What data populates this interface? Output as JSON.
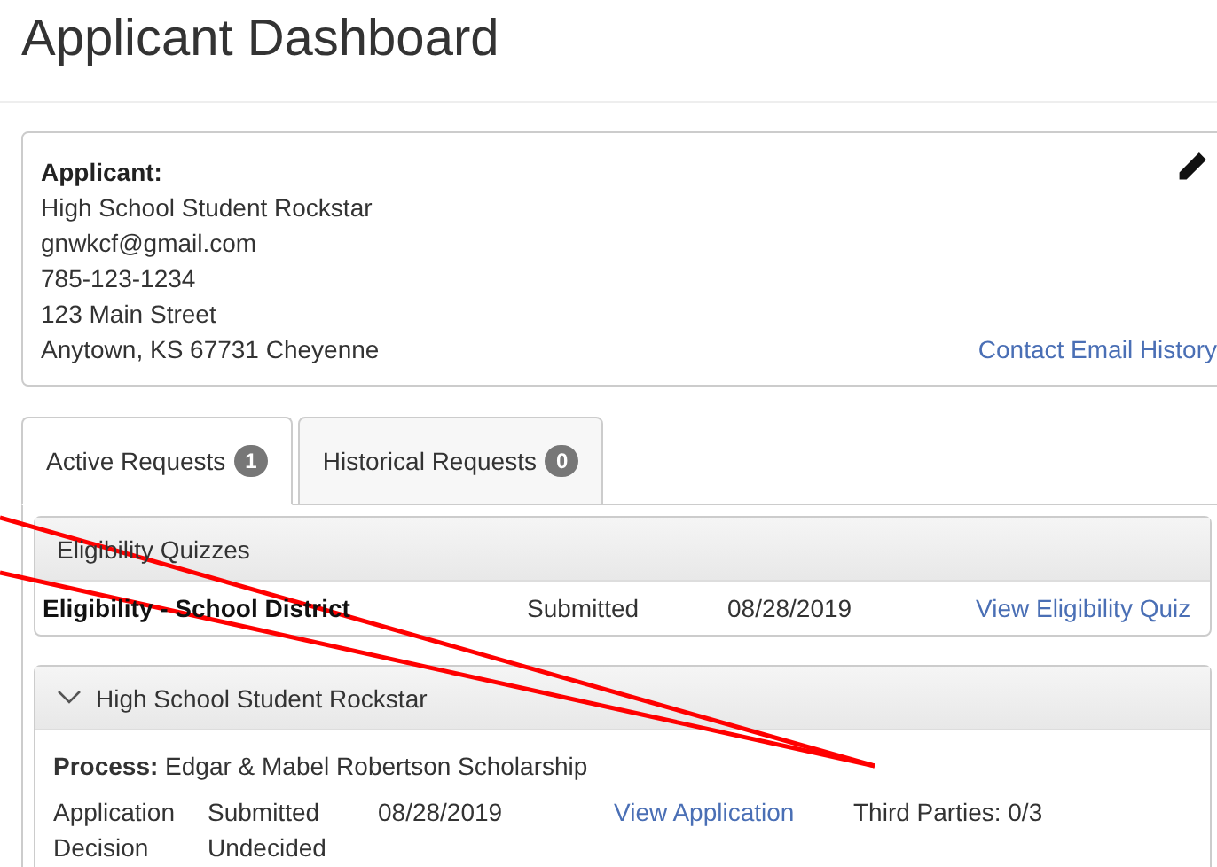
{
  "page_title": "Applicant Dashboard",
  "applicant": {
    "heading": "Applicant:",
    "lines": [
      "High School Student Rockstar",
      "gnwkcf@gmail.com",
      "785-123-1234",
      "123 Main Street",
      "Anytown, KS 67731 Cheyenne"
    ],
    "link": "Contact Email History"
  },
  "tabs": [
    {
      "label": "Active Requests",
      "count": "1",
      "selected": true
    },
    {
      "label": "Historical Requests",
      "count": "0",
      "selected": false
    }
  ],
  "eligibility": {
    "heading": "Eligibility Quizzes",
    "row": {
      "name": "Eligibility - School District",
      "status": "Submitted",
      "date": "08/28/2019",
      "link": "View Eligibility Quiz"
    }
  },
  "request": {
    "heading": "High School Student Rockstar",
    "expanded": true,
    "process_label": "Process:",
    "process": "Edgar & Mabel Robertson Scholarship",
    "rows": [
      {
        "label": "Application",
        "status": "Submitted",
        "date": "08/28/2019",
        "link": "View Application",
        "extra": "Third Parties: 0/3"
      },
      {
        "label": "Decision",
        "status": "Undecided"
      }
    ]
  }
}
